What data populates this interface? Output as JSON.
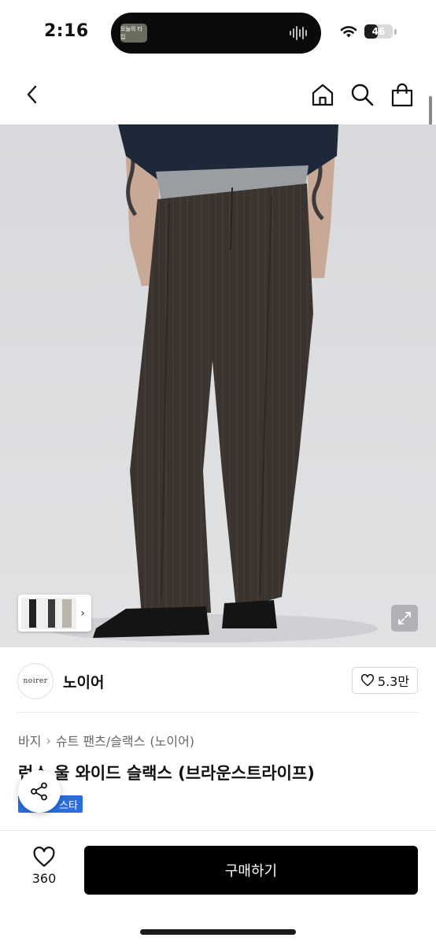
{
  "status_bar": {
    "time": "2:16",
    "island_label": "오늘의 타입",
    "battery_level": "46",
    "battery_fraction": 0.46
  },
  "header": {
    "back_icon": "chevron-left-icon",
    "icons": [
      "home-icon",
      "search-icon",
      "bag-icon"
    ]
  },
  "product": {
    "image_desc_colors": {
      "background": "#dcdcdf",
      "trousers": "#3a322d",
      "sweater": "#1e2838"
    },
    "gallery_count": 3
  },
  "brand": {
    "logo_text": "noirer",
    "name": "노이어",
    "like_count": "5.3만"
  },
  "breadcrumb": [
    "바지",
    "슈트 팬츠/슬랙스",
    "(노이어)"
  ],
  "title": "런스 울 와이드 슬랙스 (브라운스트라이프)",
  "badge": "스타",
  "bottom": {
    "wish_count": "360",
    "buy_label": "구매하기"
  },
  "colors": {
    "accent_blue": "#2a6de0",
    "buy_button": "#000000"
  }
}
